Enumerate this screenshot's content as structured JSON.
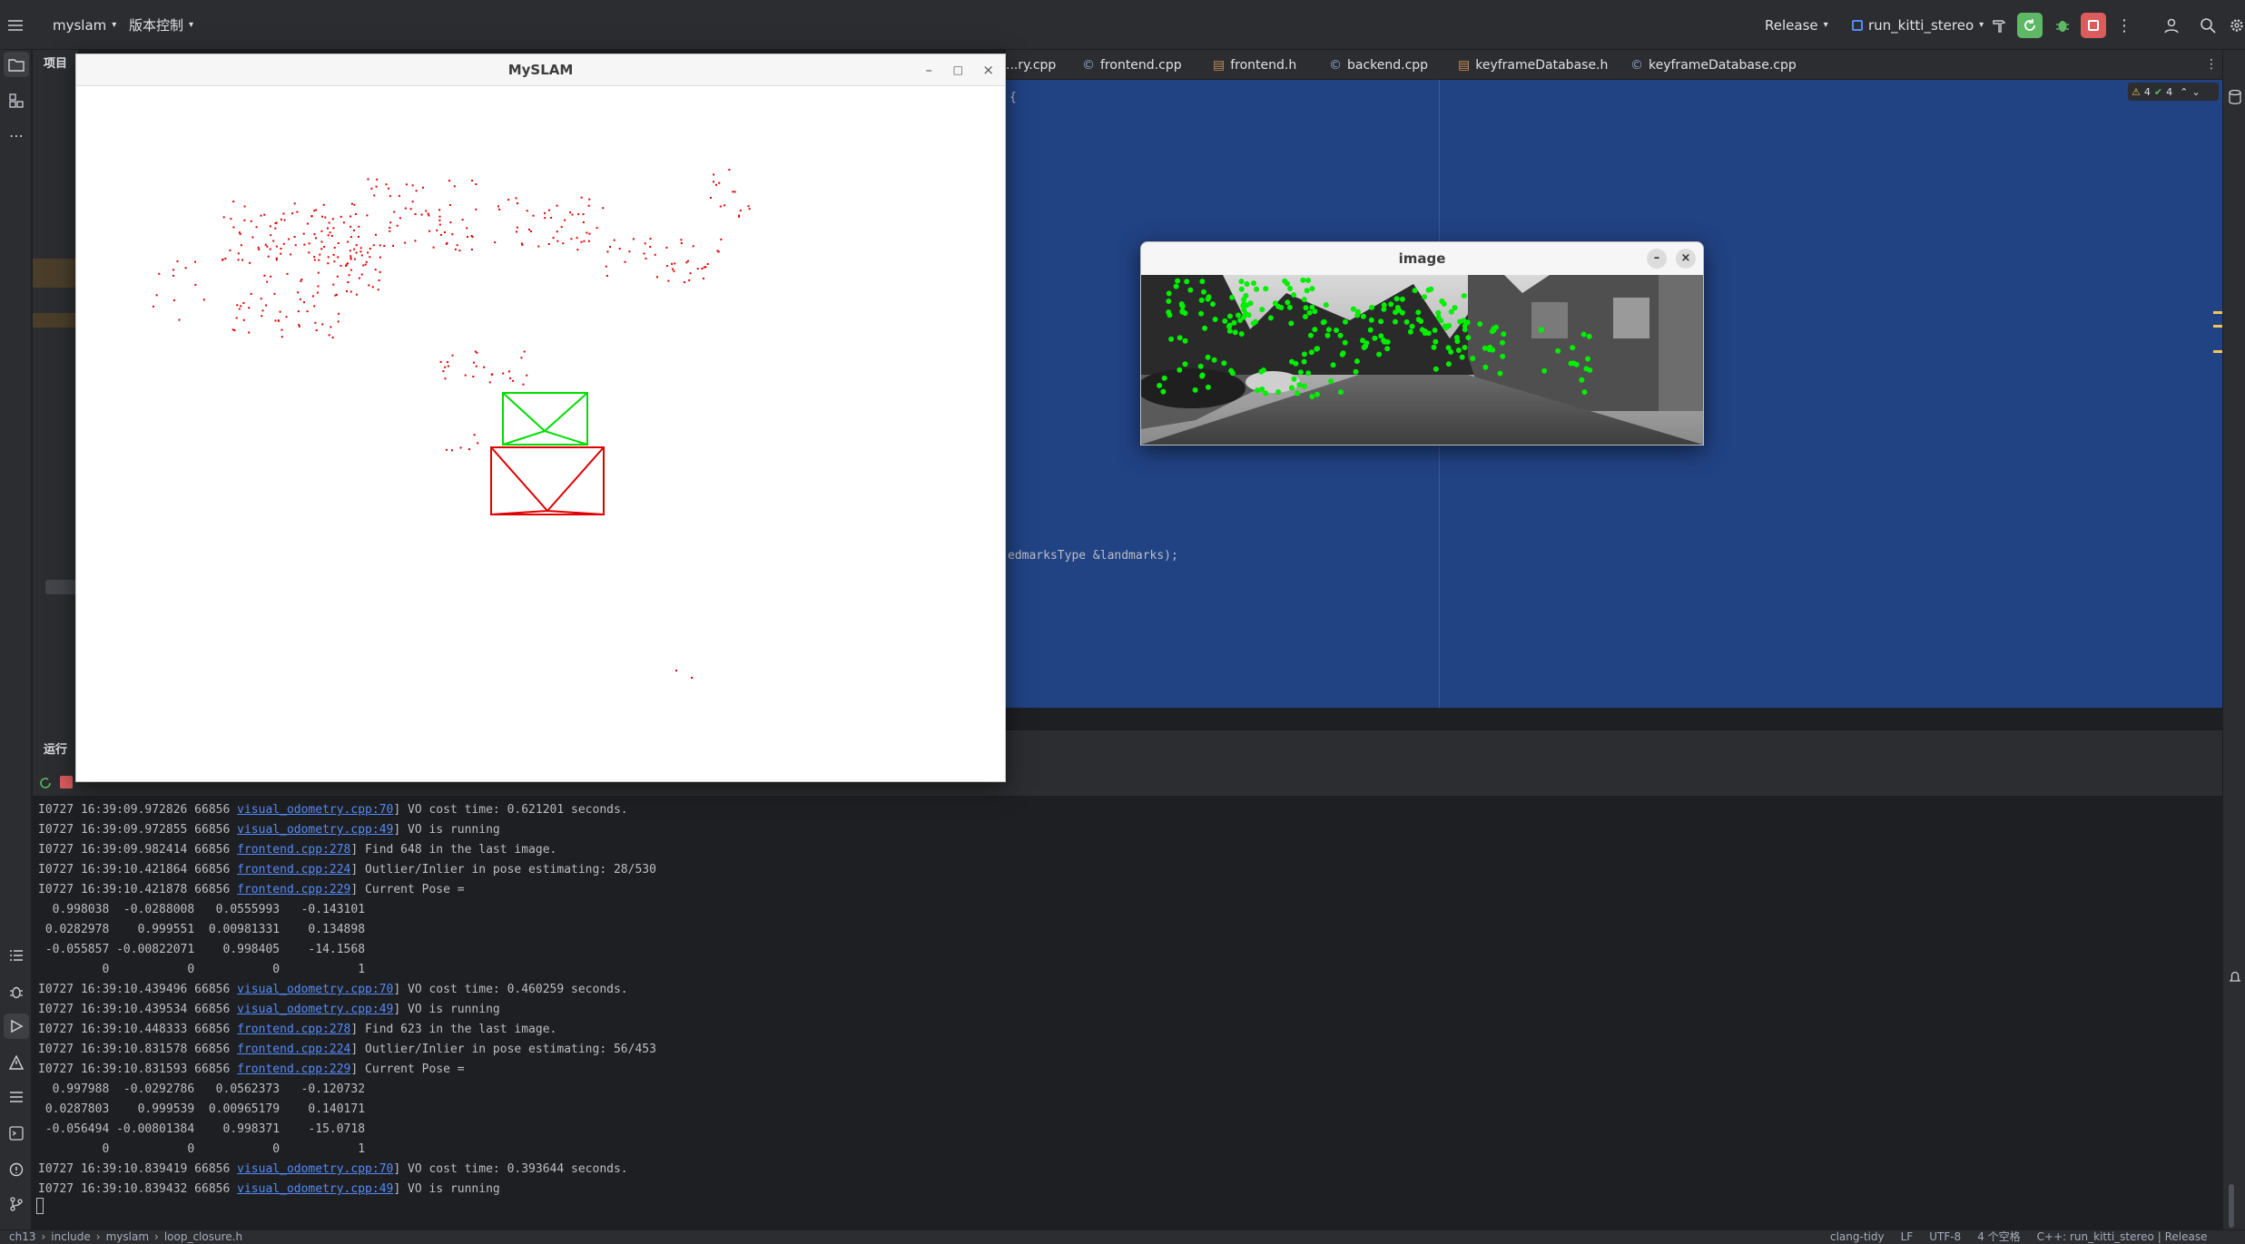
{
  "ide": {
    "project": "myslam",
    "vcs": "版本控制",
    "build_config": "Release",
    "run_config": "run_kitti_stereo",
    "project_panel_title": "项目",
    "run_panel_title": "运行",
    "tabs": [
      "...ry.cpp",
      "frontend.cpp",
      "frontend.h",
      "backend.cpp",
      "keyframeDatabase.h",
      "keyframeDatabase.cpp"
    ],
    "inspection": {
      "warnings": "4",
      "ok": "4"
    },
    "code_top": "{",
    "code_fragment": "edmarksType &landmarks);"
  },
  "myslam_window": {
    "title": "MySLAM"
  },
  "image_window": {
    "title": "image"
  },
  "console_lines": [
    {
      "pre": "I0727 16:39:09.972826 66856 ",
      "link": "visual_odometry.cpp:70",
      "post": "] VO cost time: 0.621201 seconds."
    },
    {
      "pre": "I0727 16:39:09.972855 66856 ",
      "link": "visual_odometry.cpp:49",
      "post": "] VO is running"
    },
    {
      "pre": "I0727 16:39:09.982414 66856 ",
      "link": "frontend.cpp:278",
      "post": "] Find 648 in the last image."
    },
    {
      "pre": "I0727 16:39:10.421864 66856 ",
      "link": "frontend.cpp:224",
      "post": "] Outlier/Inlier in pose estimating: 28/530"
    },
    {
      "pre": "I0727 16:39:10.421878 66856 ",
      "link": "frontend.cpp:229",
      "post": "] Current Pose ="
    },
    {
      "pre": "  0.998038  -0.0288008   0.0555993   -0.143101",
      "link": "",
      "post": ""
    },
    {
      "pre": " 0.0282978    0.999551  0.00981331    0.134898",
      "link": "",
      "post": ""
    },
    {
      "pre": " -0.055857 -0.00822071    0.998405    -14.1568",
      "link": "",
      "post": ""
    },
    {
      "pre": "         0           0           0           1",
      "link": "",
      "post": ""
    },
    {
      "pre": "I0727 16:39:10.439496 66856 ",
      "link": "visual_odometry.cpp:70",
      "post": "] VO cost time: 0.460259 seconds."
    },
    {
      "pre": "I0727 16:39:10.439534 66856 ",
      "link": "visual_odometry.cpp:49",
      "post": "] VO is running"
    },
    {
      "pre": "I0727 16:39:10.448333 66856 ",
      "link": "frontend.cpp:278",
      "post": "] Find 623 in the last image."
    },
    {
      "pre": "I0727 16:39:10.831578 66856 ",
      "link": "frontend.cpp:224",
      "post": "] Outlier/Inlier in pose estimating: 56/453"
    },
    {
      "pre": "I0727 16:39:10.831593 66856 ",
      "link": "frontend.cpp:229",
      "post": "] Current Pose ="
    },
    {
      "pre": "  0.997988  -0.0292786   0.0562373   -0.120732",
      "link": "",
      "post": ""
    },
    {
      "pre": " 0.0287803    0.999539  0.00965179    0.140171",
      "link": "",
      "post": ""
    },
    {
      "pre": " -0.056494 -0.00801384    0.998371    -15.0718",
      "link": "",
      "post": ""
    },
    {
      "pre": "         0           0           0           1",
      "link": "",
      "post": ""
    },
    {
      "pre": "I0727 16:39:10.839419 66856 ",
      "link": "visual_odometry.cpp:70",
      "post": "] VO cost time: 0.393644 seconds."
    },
    {
      "pre": "I0727 16:39:10.839432 66856 ",
      "link": "visual_odometry.cpp:49",
      "post": "] VO is running"
    }
  ],
  "status": {
    "breadcrumb": [
      "ch13",
      "include",
      "myslam",
      "loop_closure.h"
    ],
    "right": [
      "clang-tidy",
      "LF",
      "UTF-8",
      "4 个空格",
      "C++: run_kitti_stereo | Release"
    ]
  },
  "colors": {
    "editor_bg": "#214283",
    "accent": "#3574f0",
    "run_green": "#5fb865",
    "stop_red": "#db5c5c",
    "cloud_red": "#e00000",
    "feature_green": "#00ee00"
  }
}
